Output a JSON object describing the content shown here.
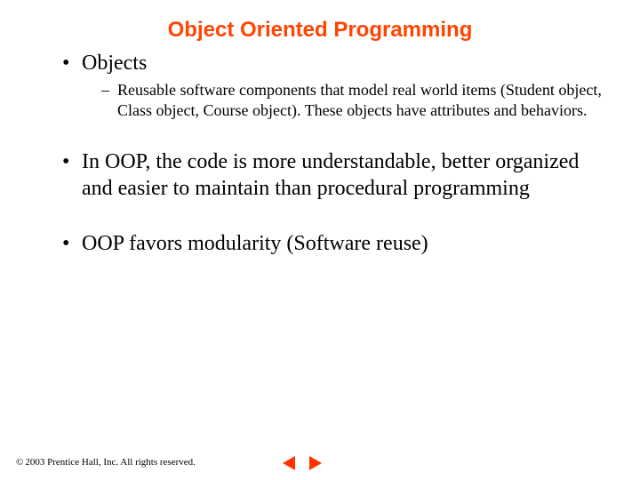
{
  "title": "Object Oriented Programming",
  "bullets": {
    "b1": {
      "text": "Objects",
      "sub1": "Reusable software components that model real world items (Student object, Class object, Course object).  These objects have attributes and behaviors."
    },
    "b2": {
      "text": "In OOP, the code is more understandable, better organized and easier to maintain than procedural programming"
    },
    "b3": {
      "text": "OOP favors modularity (Software reuse)"
    }
  },
  "footer": {
    "copyright_symbol": "©",
    "text": "2003 Prentice Hall, Inc.  All rights reserved."
  }
}
